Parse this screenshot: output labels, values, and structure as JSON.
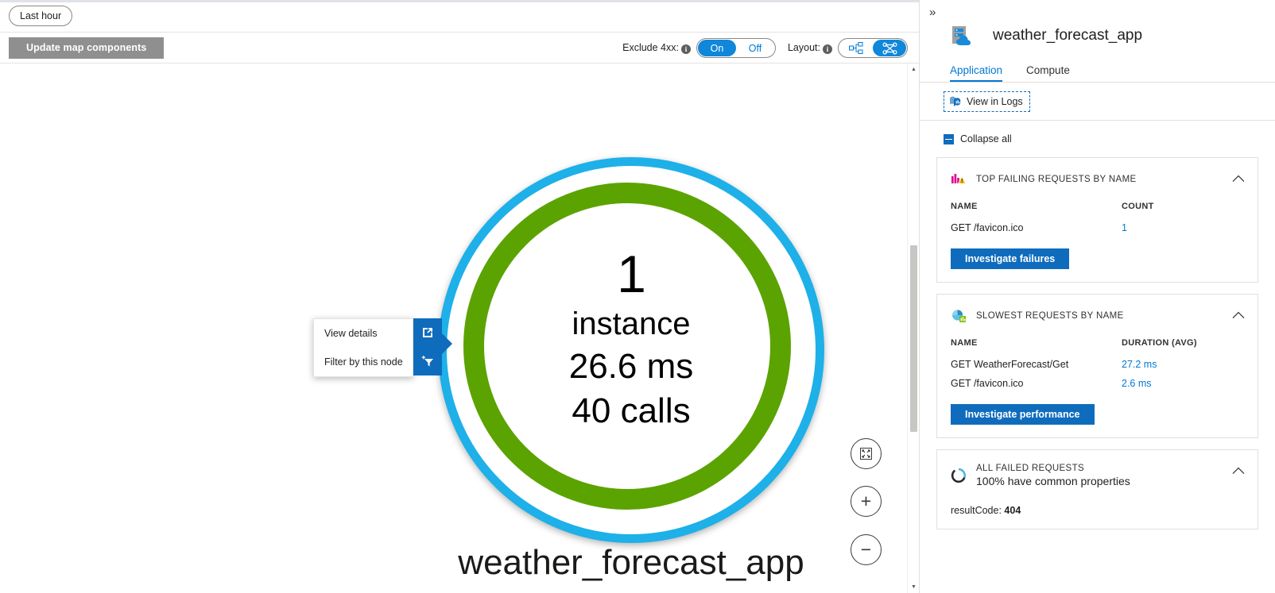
{
  "toolbar": {
    "time_range": "Last hour",
    "update_button": "Update map components",
    "exclude_label": "Exclude 4xx:",
    "exclude_on": "On",
    "exclude_off": "Off",
    "layout_label": "Layout:",
    "accent_blue": "#0078d4",
    "toggle_blue": "#0f87da"
  },
  "map": {
    "node": {
      "count": "1",
      "instance_label": "instance",
      "duration": "26.6 ms",
      "calls_number": "40",
      "calls_label": "calls",
      "name": "weather_forecast_app",
      "outer_ring_color": "#1eb0e8",
      "inner_ring_color": "#5ba300"
    },
    "context_menu": {
      "view_details": "View details",
      "filter_by_node": "Filter by this node"
    },
    "controls": {
      "fit": "fit-to-view",
      "zoom_in": "+",
      "zoom_out": "−"
    }
  },
  "panel": {
    "collapse_chevron": "»",
    "title": "weather_forecast_app",
    "tabs": [
      {
        "label": "Application",
        "active": true
      },
      {
        "label": "Compute",
        "active": false
      }
    ],
    "view_in_logs": "View in Logs",
    "collapse_all": "Collapse all",
    "cards": [
      {
        "title": "TOP FAILING REQUESTS BY NAME",
        "columns": [
          "NAME",
          "COUNT"
        ],
        "rows": [
          {
            "name": "GET /favicon.ico",
            "value": "1"
          }
        ],
        "button": "Investigate failures"
      },
      {
        "title": "SLOWEST REQUESTS BY NAME",
        "columns": [
          "NAME",
          "DURATION (AVG)"
        ],
        "rows": [
          {
            "name": "GET WeatherForecast/Get",
            "value": "27.2 ms"
          },
          {
            "name": "GET /favicon.ico",
            "value": "2.6 ms"
          }
        ],
        "button": "Investigate performance"
      },
      {
        "title": "ALL FAILED REQUESTS",
        "subtitle": "100% have common properties",
        "property_key": "resultCode:",
        "property_value": "404"
      }
    ]
  }
}
